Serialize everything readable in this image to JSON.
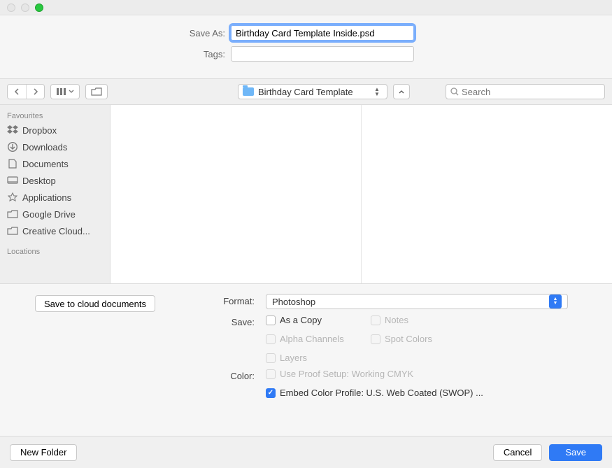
{
  "labels": {
    "save_as": "Save As:",
    "tags": "Tags:",
    "format": "Format:",
    "save": "Save:",
    "color": "Color:"
  },
  "filename": "Birthday Card Template Inside.psd",
  "tags_value": "",
  "location_folder": "Birthday Card Template",
  "search_placeholder": "Search",
  "sidebar": {
    "favourites_header": "Favourites",
    "locations_header": "Locations",
    "items": [
      {
        "label": "Dropbox",
        "icon": "dropbox-icon"
      },
      {
        "label": "Downloads",
        "icon": "downloads-icon"
      },
      {
        "label": "Documents",
        "icon": "documents-icon"
      },
      {
        "label": "Desktop",
        "icon": "desktop-icon"
      },
      {
        "label": "Applications",
        "icon": "applications-icon"
      },
      {
        "label": "Google Drive",
        "icon": "folder-icon"
      },
      {
        "label": "Creative Cloud...",
        "icon": "folder-icon"
      }
    ]
  },
  "cloud_button": "Save to cloud documents",
  "format_value": "Photoshop",
  "save_options": {
    "as_a_copy": {
      "label": "As a Copy",
      "checked": false,
      "enabled": true
    },
    "notes": {
      "label": "Notes",
      "checked": false,
      "enabled": false
    },
    "alpha_channels": {
      "label": "Alpha Channels",
      "checked": false,
      "enabled": false
    },
    "spot_colors": {
      "label": "Spot Colors",
      "checked": false,
      "enabled": false
    },
    "layers": {
      "label": "Layers",
      "checked": false,
      "enabled": false
    }
  },
  "color_options": {
    "use_proof": {
      "label": "Use Proof Setup:  Working CMYK",
      "checked": false,
      "enabled": false
    },
    "embed_profile": {
      "label": "Embed Color Profile:  U.S. Web Coated (SWOP) ...",
      "checked": true,
      "enabled": true
    }
  },
  "footer": {
    "new_folder": "New Folder",
    "cancel": "Cancel",
    "save": "Save"
  }
}
